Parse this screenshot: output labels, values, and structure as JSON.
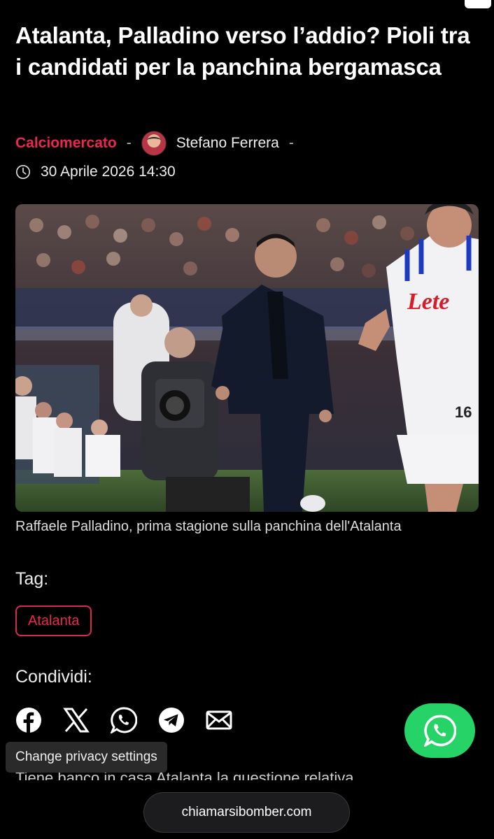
{
  "article": {
    "title": "Atalanta, Palladino verso l’addio? Pioli tra i candidati per la panchina bergamasca",
    "category": "Calciomercato",
    "separator": "-",
    "author": "Stefano Ferrera",
    "date": "30 Aprile 2026 14:30",
    "caption": "Raffaele Palladino, prima stagione sulla panchina dell'Atalanta",
    "partial_body_text": "Tiene banco in casa Atalanta la questione relativa"
  },
  "hero_image": {
    "sponsor_text": "Lete",
    "shirt_number": "16"
  },
  "tags": {
    "heading": "Tag:",
    "items": [
      "Atalanta"
    ]
  },
  "share": {
    "heading": "Condividi:",
    "icons": [
      "facebook-icon",
      "x-icon",
      "whatsapp-icon",
      "telegram-icon",
      "email-icon"
    ]
  },
  "privacy": {
    "label": "Change privacy settings"
  },
  "browser": {
    "url": "chiamarsibomber.com"
  },
  "colors": {
    "accent": "#e8284e",
    "whatsapp": "#25d366",
    "background": "#000000"
  }
}
